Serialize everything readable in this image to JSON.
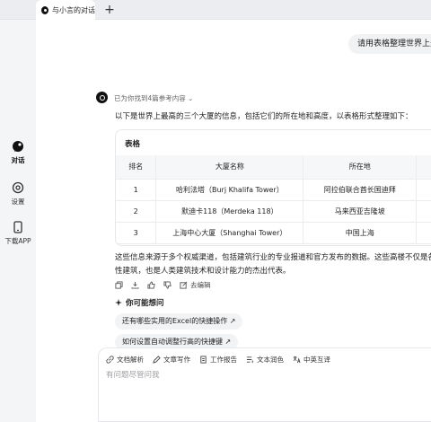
{
  "tab": {
    "title": "与小言的对话",
    "new_tab_label": "+"
  },
  "sidebar": {
    "items": [
      {
        "label": "对话",
        "icon": "chat-icon",
        "active": true
      },
      {
        "label": "设置",
        "icon": "settings-icon",
        "active": false
      },
      {
        "label": "下载APP",
        "icon": "download-app-icon",
        "active": false
      }
    ]
  },
  "conversation": {
    "user_message": "请用表格整理世界上最",
    "sources_text": "已为你找到4篇参考内容",
    "intro": "以下是世界上最高的三个大厦的信息，包括它们的所在地和高度，以表格形式整理如下：",
    "table": {
      "title": "表格",
      "headers": [
        "排名",
        "大厦名称",
        "所在地"
      ],
      "rows": [
        [
          "1",
          "哈利法塔（Burj Khalifa Tower）",
          "阿拉伯联合酋长国迪拜"
        ],
        [
          "2",
          "默迪卡118（Merdeka 118）",
          "马来西亚吉隆坡"
        ],
        [
          "3",
          "上海中心大厦（Shanghai Tower）",
          "中国上海"
        ]
      ]
    },
    "outro_line1": "这些信息来源于多个权威渠道，包括建筑行业的专业报道和官方发布的数据。这些高楼不仅是各",
    "outro_line2": "性建筑，也是人类建筑技术和设计能力的杰出代表。",
    "actions": {
      "edit_label": "去编辑"
    }
  },
  "suggestions": {
    "heading": "你可能想问",
    "items": [
      "还有哪些实用的Excel的快捷操作 ↗",
      "如何设置自动调整行高的快捷键 ↗"
    ]
  },
  "composer": {
    "tools": [
      "文档解析",
      "文章写作",
      "工作报告",
      "文本润色",
      "中英互译"
    ],
    "placeholder": "有问题尽管问我"
  }
}
